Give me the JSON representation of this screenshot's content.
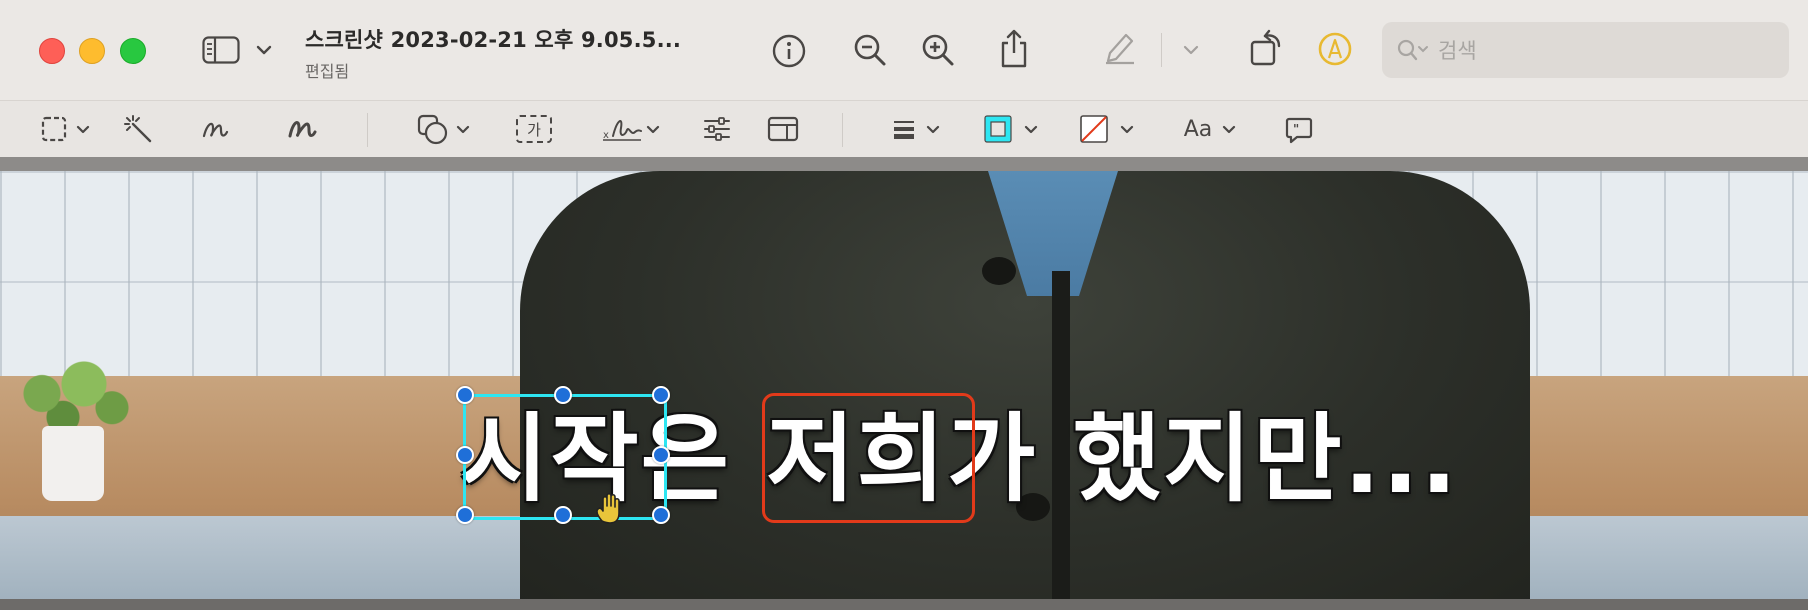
{
  "titlebar": {
    "title": "스크린샷 2023-02-21 오후 9.05.5...",
    "subtitle": "편집됨",
    "search_placeholder": "검색"
  },
  "toolbar_icons": [
    "sidebar-icon",
    "chevron-down-icon",
    "info-icon",
    "zoom-out-icon",
    "zoom-in-icon",
    "share-icon",
    "highlight-pen-icon",
    "rotate-icon",
    "markup-icon",
    "search-icon"
  ],
  "markup_toolbar": {
    "text_tool_label": "가",
    "font_label": "Aa"
  },
  "canvas": {
    "caption": "시작은 저희가 했지만..."
  },
  "colors": {
    "selection": "#2ee6f2",
    "handle": "#1f6fd8",
    "rectangle": "#e23a1a",
    "accent": "#e8b931"
  }
}
